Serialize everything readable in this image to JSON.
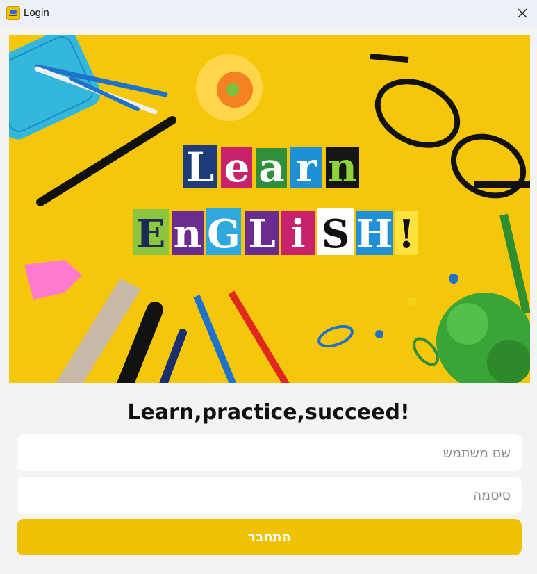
{
  "window": {
    "title": "Login",
    "icon": "app-logo-icon",
    "close_icon": "close-icon"
  },
  "hero": {
    "line1": [
      "L",
      "e",
      "a",
      "r",
      "n"
    ],
    "line2": [
      "E",
      "n",
      "G",
      "L",
      "i",
      "S",
      "H",
      "!"
    ]
  },
  "tagline": "Learn,practice,succeed!",
  "form": {
    "username_placeholder": "שם משתמש",
    "username_value": "",
    "password_placeholder": "סיסמה",
    "password_value": "",
    "submit_label": "התחבר"
  },
  "colors": {
    "accent": "#f0c100",
    "hero_bg": "#f6c60a",
    "background": "#f3f3f3"
  }
}
